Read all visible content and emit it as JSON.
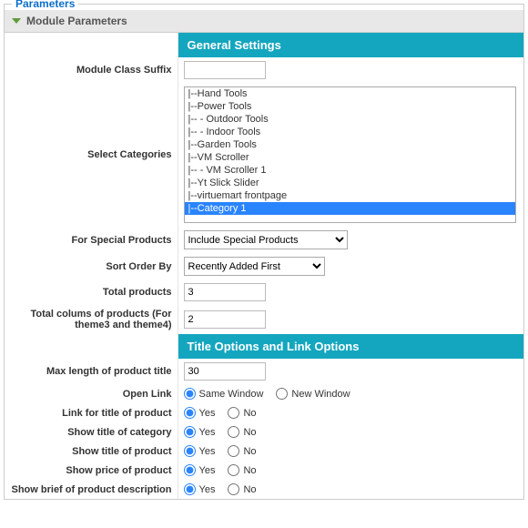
{
  "fieldset": {
    "legend": "Parameters"
  },
  "panel": {
    "title": "Module Parameters"
  },
  "sections": {
    "general": "General Settings",
    "title_link": "Title Options and Link Options"
  },
  "labels": {
    "module_class_suffix": "Module Class Suffix",
    "select_categories": "Select Categories",
    "for_special": "For Special Products",
    "sort_order": "Sort Order By",
    "total_products": "Total products",
    "total_columns": "Total colums of products (For theme3 and theme4)",
    "max_title": "Max length of product title",
    "open_link": "Open Link",
    "link_title": "Link for title of product",
    "show_cat_title": "Show title of category",
    "show_prod_title": "Show title of product",
    "show_price": "Show price of product",
    "show_brief": "Show brief of product description"
  },
  "values": {
    "module_class_suffix": "",
    "for_special": "Include Special Products",
    "sort_order": "Recently Added First",
    "total_products": "3",
    "total_columns": "2",
    "max_title": "30"
  },
  "radios": {
    "same_window": "Same Window",
    "new_window": "New Window",
    "yes": "Yes",
    "no": "No"
  },
  "categories": [
    "|--Hand Tools",
    "|--Power Tools",
    "|--  - Outdoor Tools",
    "|--  - Indoor Tools",
    "|--Garden Tools",
    "|--VM Scroller",
    "|--  - VM Scroller 1",
    "|--Yt Slick Slider",
    "|--virtuemart frontpage",
    "|--Category 1"
  ],
  "categories_selected_index": 9
}
